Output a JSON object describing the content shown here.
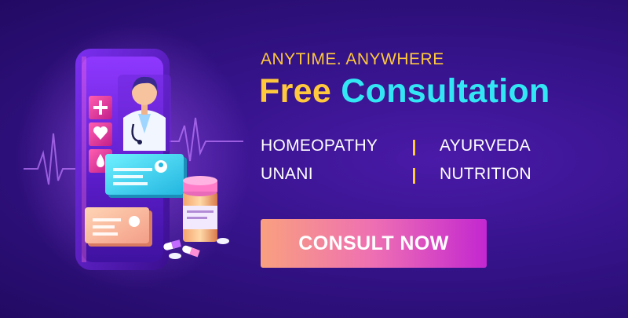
{
  "banner": {
    "tagline": "ANYTIME. ANYWHERE",
    "headline_part1": "Free",
    "headline_part2": "Consultation",
    "services": [
      {
        "left": "HOMEOPATHY",
        "right": "AYURVEDA"
      },
      {
        "left": "UNANI",
        "right": "NUTRITION"
      }
    ],
    "cta_label": "CONSULT NOW"
  },
  "colors": {
    "background": "#35138a",
    "accent_yellow": "#ffc83d",
    "accent_cyan": "#33e6f4",
    "cta_gradient_start": "#f9a07f",
    "cta_gradient_end": "#c327d0"
  },
  "illustration": {
    "icons": [
      "smartphone-icon",
      "doctor-avatar-icon",
      "plus-icon",
      "heart-icon",
      "drop-icon",
      "pill-bottle-icon",
      "pill-icon",
      "profile-card-icon"
    ]
  }
}
